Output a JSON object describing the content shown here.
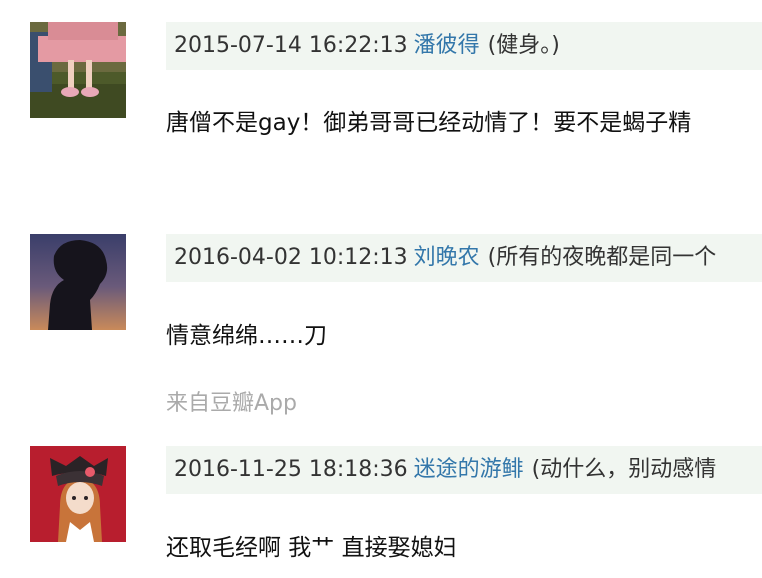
{
  "comments": [
    {
      "time": "2015-07-14 16:22:13",
      "user": "潘彼得",
      "signature": "(健身。)",
      "text": "唐僧不是gay！御弟哥哥已经动情了！要不是蝎子精",
      "avatar_icon": "avatar-girl-photo-icon"
    },
    {
      "time": "2016-04-02 10:12:13",
      "user": "刘晚农",
      "signature": "(所有的夜晚都是同一个",
      "text": "情意绵绵……刀",
      "source": "来自豆瓣App",
      "avatar_icon": "avatar-silhouette-icon"
    },
    {
      "time": "2016-11-25 18:18:36",
      "user": "迷途的游鲱",
      "signature": "(动什么，别动感情",
      "text": "还取毛经啊 我艹 直接娶媳妇",
      "avatar_icon": "avatar-anime-icon"
    }
  ]
}
